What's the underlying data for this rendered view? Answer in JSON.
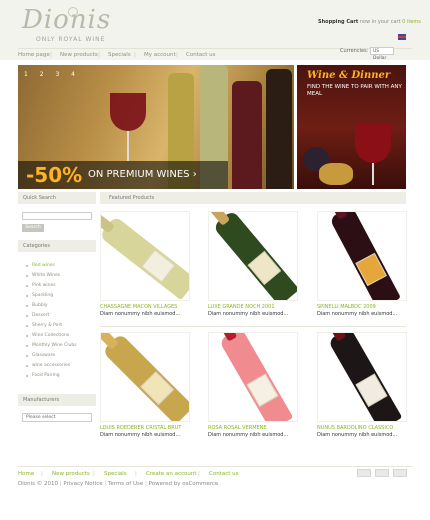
{
  "header": {
    "logo_word": "Dionis",
    "logo_tagline": "ONLY ROYAL WINE",
    "cart_label": "Shopping Cart",
    "cart_text": "now in your cart",
    "cart_link": "0 items"
  },
  "nav": {
    "items": [
      "Home page",
      "New products",
      "Specials",
      "My account",
      "Contact us"
    ]
  },
  "currency": {
    "label": "Currencies:",
    "selected": "US Dollar"
  },
  "slider": {
    "dots": "1 2 3 4",
    "discount": "-50%",
    "text": "ON PREMIUM WINES ›"
  },
  "banner": {
    "title": "Wine & Dinner",
    "subtitle": "FIND THE WINE TO PAIR WITH ANY MEAL"
  },
  "sidebar": {
    "quick_search": "Quick Search",
    "search_button": "Search",
    "categories_title": "Categories",
    "categories": [
      "Red wines",
      "White Wines",
      "Pink wines",
      "Sparkling",
      "Bubbly",
      "Dessert",
      "Sherry & Port",
      "Wine Collections",
      "Monthly Wine Clubs",
      "Glassware",
      "wine accessories",
      "Food Pairing"
    ],
    "active_category": 0,
    "manufacturers_title": "Manufacturers",
    "manufacturers_select": "Please select"
  },
  "featured": {
    "title": "Featured Products",
    "products": [
      {
        "name": "CHASSAGNE MACON VILLAGES",
        "desc": "Diam nonummy nibh euismod...",
        "bottle": "#d7d59a",
        "neck": "#c9c483",
        "label": "#f3efe0"
      },
      {
        "name": "LUXE GRANDE NOCH 2001",
        "desc": "Diam nonummy nibh euismod...",
        "bottle": "#2f4a1e",
        "neck": "#c9a45c",
        "label": "#efe6c8"
      },
      {
        "name": "SPINELLI MALBOC 2009",
        "desc": "Diam nonummy nibh euismod...",
        "bottle": "#2b0f14",
        "neck": "#5c1520",
        "label": "#e7a63a"
      },
      {
        "name": "LOUIS ROEDERER CRISTAL BRUT",
        "desc": "Diam nonummy nibh euismod...",
        "bottle": "#c8a64e",
        "neck": "#d8b25a",
        "label": "#f1e4b6"
      },
      {
        "name": "ROSA ROSAL VERMENE",
        "desc": "Diam nonummy nibh euismod...",
        "bottle": "#f08b8f",
        "neck": "#b71a2a",
        "label": "#f6efe3"
      },
      {
        "name": "NUNUS BARDOLINO CLASSICO",
        "desc": "Diam nonummy nibh euismod...",
        "bottle": "#1c1616",
        "neck": "#6b1117",
        "label": "#f0ece2"
      }
    ]
  },
  "footer": {
    "links": [
      "Home",
      "New products",
      "Specials",
      "Create an account",
      "Contact us"
    ],
    "copyright": "Dionis © 2010",
    "privacy": "Privacy Notice",
    "terms": "Terms of Use",
    "powered": "Powered by osCommerce"
  },
  "colors": {
    "accent_green": "#8bb326",
    "promo_orange": "#ffb321",
    "banner_red": "#6f1e14"
  }
}
